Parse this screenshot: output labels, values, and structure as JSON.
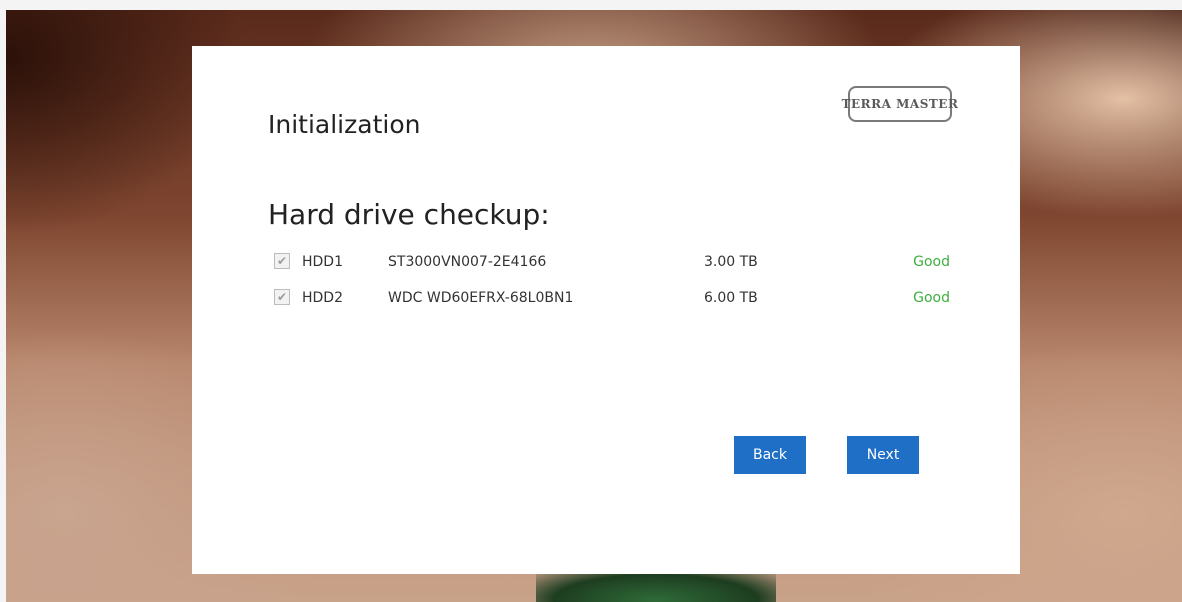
{
  "dialog": {
    "title": "Initialization",
    "logo_text": "TERRA MASTER",
    "section_heading": "Hard drive checkup:",
    "drives": [
      {
        "id": "HDD1",
        "model": "ST3000VN007-2E4166",
        "size": "3.00 TB",
        "status": "Good",
        "checked": true
      },
      {
        "id": "HDD2",
        "model": "WDC WD60EFRX-68L0BN1",
        "size": "6.00 TB",
        "status": "Good",
        "checked": true
      }
    ],
    "buttons": {
      "back_label": "Back",
      "next_label": "Next"
    }
  },
  "colors": {
    "button": "#1f6fc6",
    "status_good": "#3fae3f",
    "dialog_bg": "#ffffff"
  },
  "icons": {
    "checkbox": "checkmark-icon"
  }
}
